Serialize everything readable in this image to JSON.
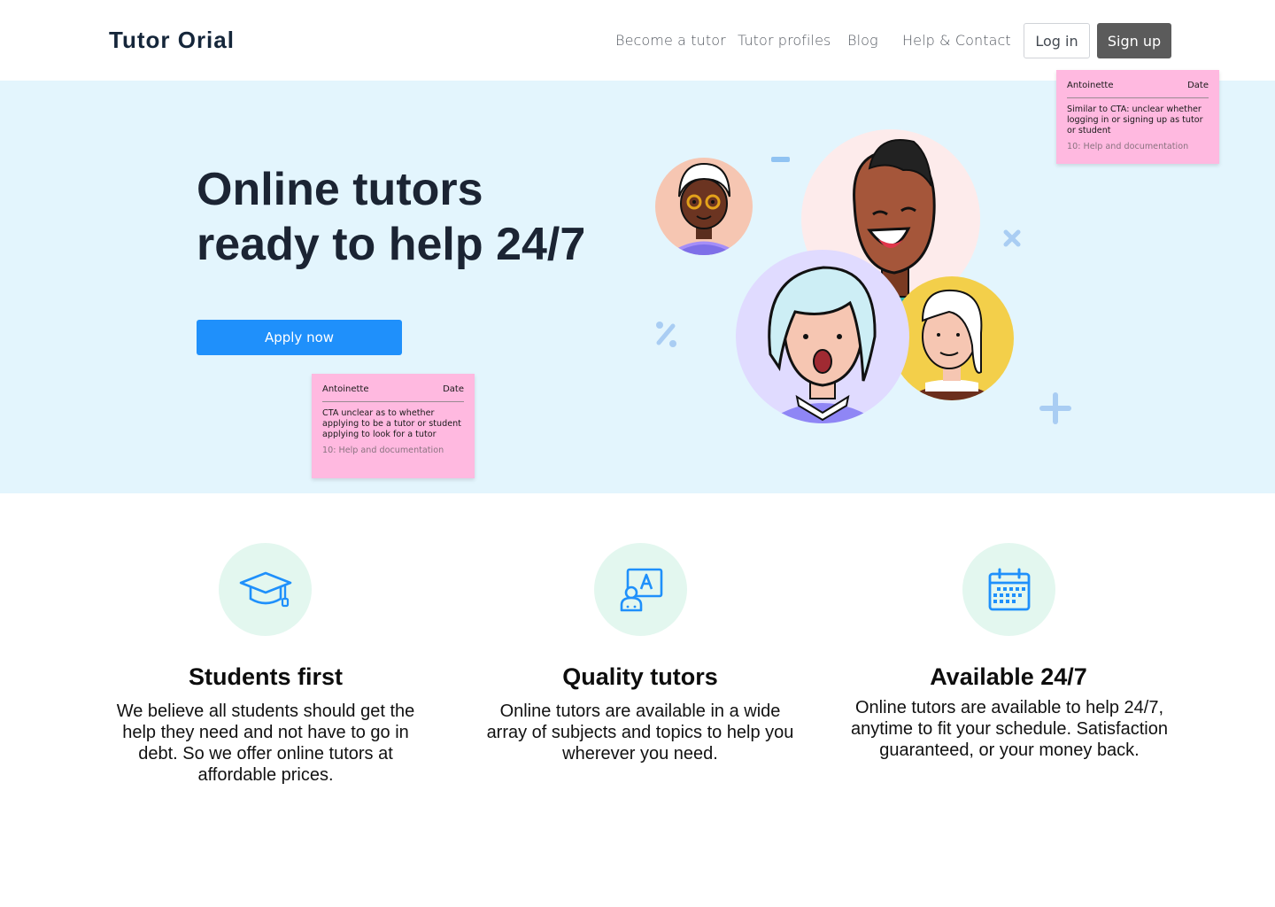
{
  "header": {
    "brand": "Tutor Orial",
    "nav": [
      "Become a tutor",
      "Tutor profiles",
      "Blog",
      "Help & Contact"
    ],
    "login_label": "Log in",
    "signup_label": "Sign up"
  },
  "hero": {
    "title_line1": "Online tutors",
    "title_line2": "ready to help 24/7",
    "cta_label": "Apply now"
  },
  "notes": [
    {
      "author": "Antoinette",
      "date_label": "Date",
      "body": "Similar to CTA: unclear whether logging in or signing up as tutor or student",
      "tag": "10: Help and documentation"
    },
    {
      "author": "Antoinette",
      "date_label": "Date",
      "body": "CTA unclear as to whether applying to be a tutor or student applying to look for a tutor",
      "tag": "10: Help and documentation"
    }
  ],
  "features": [
    {
      "icon": "graduation-cap-icon",
      "title": "Students first",
      "text": "We believe all students should get the help they need and not have to go in debt. So we offer online tutors at affordable prices."
    },
    {
      "icon": "teacher-board-icon",
      "title": "Quality tutors",
      "text": "Online tutors are available in a wide array of subjects and topics to help you wherever you need."
    },
    {
      "icon": "calendar-icon",
      "title": "Available 24/7",
      "text": "Online tutors are available to help 24/7, anytime to fit your schedule. Satisfaction guaranteed, or your money back."
    }
  ],
  "colors": {
    "hero_bg": "#e3f5fd",
    "accent_blue": "#1f90fb",
    "signup_bg": "#5b5b5b",
    "note_pink": "#ffb9e0",
    "feature_circle": "#e3f7ef"
  }
}
